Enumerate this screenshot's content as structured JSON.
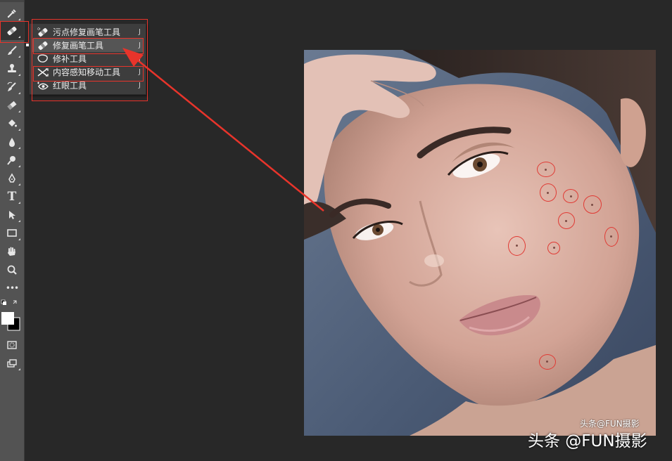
{
  "toolbar": {
    "tools": [
      {
        "icon": "eyedropper-icon"
      },
      {
        "icon": "healing-brush-icon",
        "selected": true
      },
      {
        "icon": "brush-icon"
      },
      {
        "icon": "clone-stamp-icon"
      },
      {
        "icon": "history-brush-icon"
      },
      {
        "icon": "eraser-icon"
      },
      {
        "icon": "paint-bucket-icon"
      },
      {
        "icon": "blur-icon"
      },
      {
        "icon": "dodge-icon"
      },
      {
        "icon": "pen-icon"
      },
      {
        "icon": "type-icon",
        "label": "T"
      },
      {
        "icon": "path-selection-icon"
      },
      {
        "icon": "rectangle-icon"
      },
      {
        "icon": "hand-icon"
      },
      {
        "icon": "zoom-icon"
      },
      {
        "icon": "more-tools-icon",
        "label": "•••"
      },
      {
        "icon": "color-swatches-icon"
      },
      {
        "icon": "quick-mask-icon"
      },
      {
        "icon": "screen-mode-icon"
      }
    ]
  },
  "flyout": {
    "items": [
      {
        "label": "污点修复画笔工具",
        "shortcut": "J",
        "icon": "spot-healing-brush-icon"
      },
      {
        "label": "修复画笔工具",
        "shortcut": "J",
        "icon": "healing-brush-icon",
        "active": true
      },
      {
        "label": "修补工具",
        "shortcut": "J",
        "icon": "patch-icon"
      },
      {
        "label": "内容感知移动工具",
        "shortcut": "J",
        "icon": "content-aware-move-icon"
      },
      {
        "label": "红眼工具",
        "shortcut": "J",
        "icon": "red-eye-icon"
      }
    ]
  },
  "colors": {
    "annotation_red": "#e8342b",
    "panel": "#535353",
    "workspace": "#282828"
  },
  "watermark": {
    "small": "头条@FUN摄影",
    "large": "头条 @FUN摄影"
  }
}
